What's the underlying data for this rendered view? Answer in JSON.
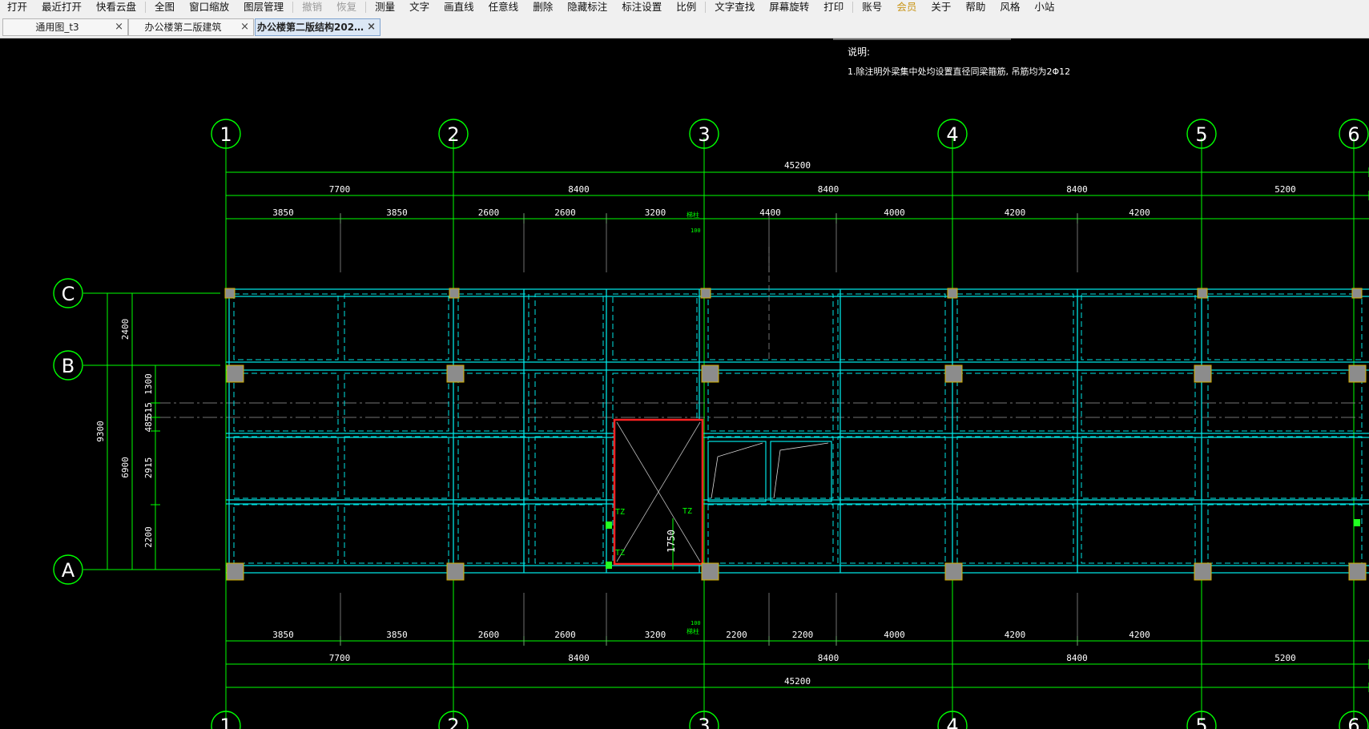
{
  "menu": [
    {
      "label": "打开",
      "state": "normal"
    },
    {
      "label": "最近打开",
      "state": "normal"
    },
    {
      "label": "快看云盘",
      "state": "normal"
    },
    {
      "label": "全图",
      "state": "normal"
    },
    {
      "label": "窗口缩放",
      "state": "normal"
    },
    {
      "label": "图层管理",
      "state": "normal"
    },
    {
      "label": "撤销",
      "state": "disabled"
    },
    {
      "label": "恢复",
      "state": "disabled"
    },
    {
      "label": "测量",
      "state": "normal"
    },
    {
      "label": "文字",
      "state": "normal"
    },
    {
      "label": "画直线",
      "state": "normal"
    },
    {
      "label": "任意线",
      "state": "normal"
    },
    {
      "label": "删除",
      "state": "normal"
    },
    {
      "label": "隐藏标注",
      "state": "normal"
    },
    {
      "label": "标注设置",
      "state": "normal"
    },
    {
      "label": "比例",
      "state": "normal"
    },
    {
      "label": "文字查找",
      "state": "normal"
    },
    {
      "label": "屏幕旋转",
      "state": "normal"
    },
    {
      "label": "打印",
      "state": "normal"
    },
    {
      "label": "账号",
      "state": "normal"
    },
    {
      "label": "会员",
      "state": "highlight"
    },
    {
      "label": "关于",
      "state": "normal"
    },
    {
      "label": "帮助",
      "state": "normal"
    },
    {
      "label": "风格",
      "state": "normal"
    },
    {
      "label": "小站",
      "state": "normal"
    }
  ],
  "tabs": [
    {
      "label": "通用图_t3",
      "active": false
    },
    {
      "label": "办公楼第二版建筑",
      "active": false
    },
    {
      "label": "办公楼第二版结构202…",
      "active": true
    }
  ],
  "tab_close_glyph": "×",
  "colors": {
    "background": "#000000",
    "grid": "#00ff00",
    "beam": "#00e5e5",
    "column": "#8c8c8c",
    "highlight": "#ff2222"
  },
  "drawing": {
    "notes": {
      "title": "说明:",
      "line1": "1.除注明外梁集中处均设置直径同梁箍筋, 吊筋均为2Φ12"
    },
    "axes_x": [
      "1",
      "2",
      "3",
      "4",
      "5",
      "6"
    ],
    "axes_y": [
      "C",
      "B",
      "A"
    ],
    "top_dims": {
      "overall": "45200",
      "row2": [
        "7700",
        "8400",
        "8400",
        "8400",
        "5200"
      ],
      "row3": [
        "3850",
        "3850",
        "2600",
        "2600",
        "3200",
        "4400",
        "4000",
        "4200",
        "4200"
      ]
    },
    "bottom_dims": {
      "overall": "45200",
      "row2": [
        "7700",
        "8400",
        "8400",
        "8400",
        "5200"
      ],
      "row3": [
        "3850",
        "3850",
        "2600",
        "2600",
        "3200",
        "2200",
        "2200",
        "4000",
        "4200",
        "4200"
      ]
    },
    "left_dims": {
      "overall": "9300",
      "spans": [
        "2400",
        "6900"
      ],
      "detail": [
        "1300",
        "515",
        "485",
        "2915",
        "2200"
      ]
    },
    "tz_labels": [
      "TZ",
      "TZ",
      "TZ"
    ],
    "stair_dim": "1750",
    "small_labels": [
      "梯柱",
      "100"
    ]
  }
}
